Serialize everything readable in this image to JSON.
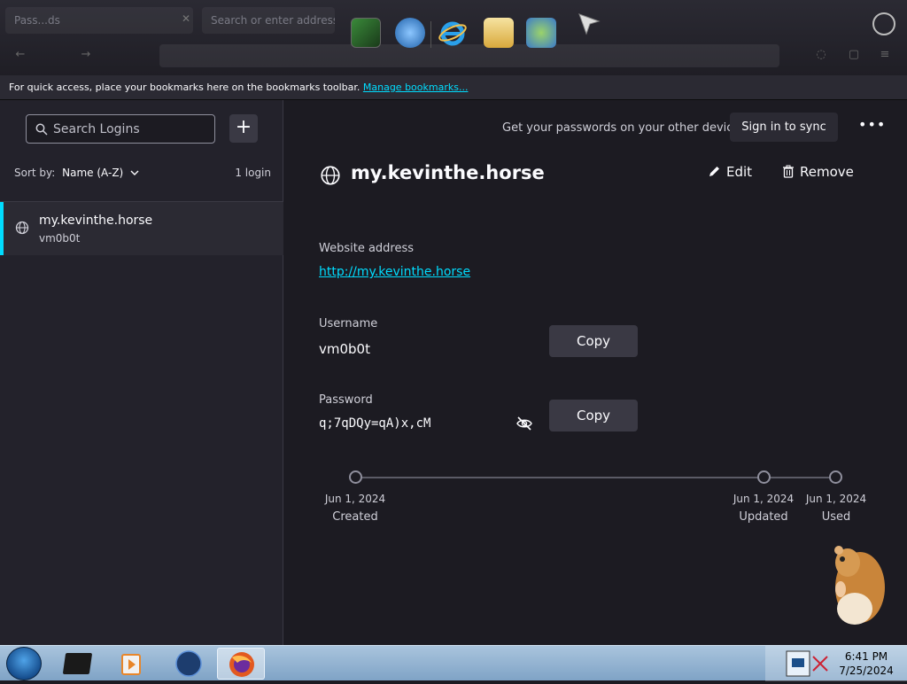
{
  "browser": {
    "tab_title": "Pass...ds",
    "tab2_title": "Search or enter address"
  },
  "bookmarks_bar": {
    "message": "For quick access, place your bookmarks here on the bookmarks toolbar.",
    "manage_link": "Manage bookmarks..."
  },
  "sidebar": {
    "search_placeholder": "Search Logins",
    "add_label": "+",
    "sort_label": "Sort by:",
    "sort_value": "Name (A-Z)",
    "login_count": "1 login",
    "logins": [
      {
        "title": "my.kevinthe.horse",
        "username": "vm0b0t"
      }
    ]
  },
  "header": {
    "sync_prompt": "Get your passwords on your other devices",
    "sync_button": "Sign in to sync",
    "menu_label": "•••"
  },
  "detail": {
    "title": "my.kevinthe.horse",
    "edit_label": "Edit",
    "remove_label": "Remove",
    "website_label": "Website address",
    "website_value": "http://my.kevinthe.horse",
    "username_label": "Username",
    "username_value": "vm0b0t",
    "password_label": "Password",
    "password_value": "q;7qDQy=qA)x,cM",
    "copy_label": "Copy"
  },
  "timeline": [
    {
      "date": "Jun 1, 2024",
      "label": "Created"
    },
    {
      "date": "Jun 1, 2024",
      "label": "Updated"
    },
    {
      "date": "Jun 1, 2024",
      "label": "Used"
    }
  ],
  "taskbar": {
    "time": "6:41 PM",
    "date": "7/25/2024"
  },
  "colors": {
    "accent": "#00ddff",
    "background": "#1c1b22",
    "sidebar": "#23222b"
  }
}
